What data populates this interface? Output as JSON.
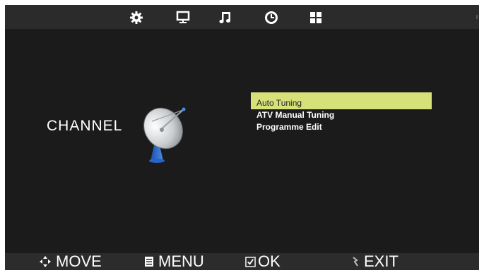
{
  "section_title": "CHANNEL",
  "top_icons": [
    "gear-icon",
    "monitor-icon",
    "music-note-icon",
    "clock-icon",
    "grid-icon"
  ],
  "menu": {
    "items": [
      {
        "label": "Auto Tuning",
        "selected": true
      },
      {
        "label": "ATV Manual Tuning",
        "selected": false
      },
      {
        "label": "Programme Edit",
        "selected": false
      }
    ]
  },
  "hints": {
    "move": "MOVE",
    "menu": "MENU",
    "ok": "OK",
    "exit": "EXIT"
  },
  "colors": {
    "highlight": "#d7e17a",
    "background": "#1b1b1b",
    "bar": "#2b2b2b"
  }
}
